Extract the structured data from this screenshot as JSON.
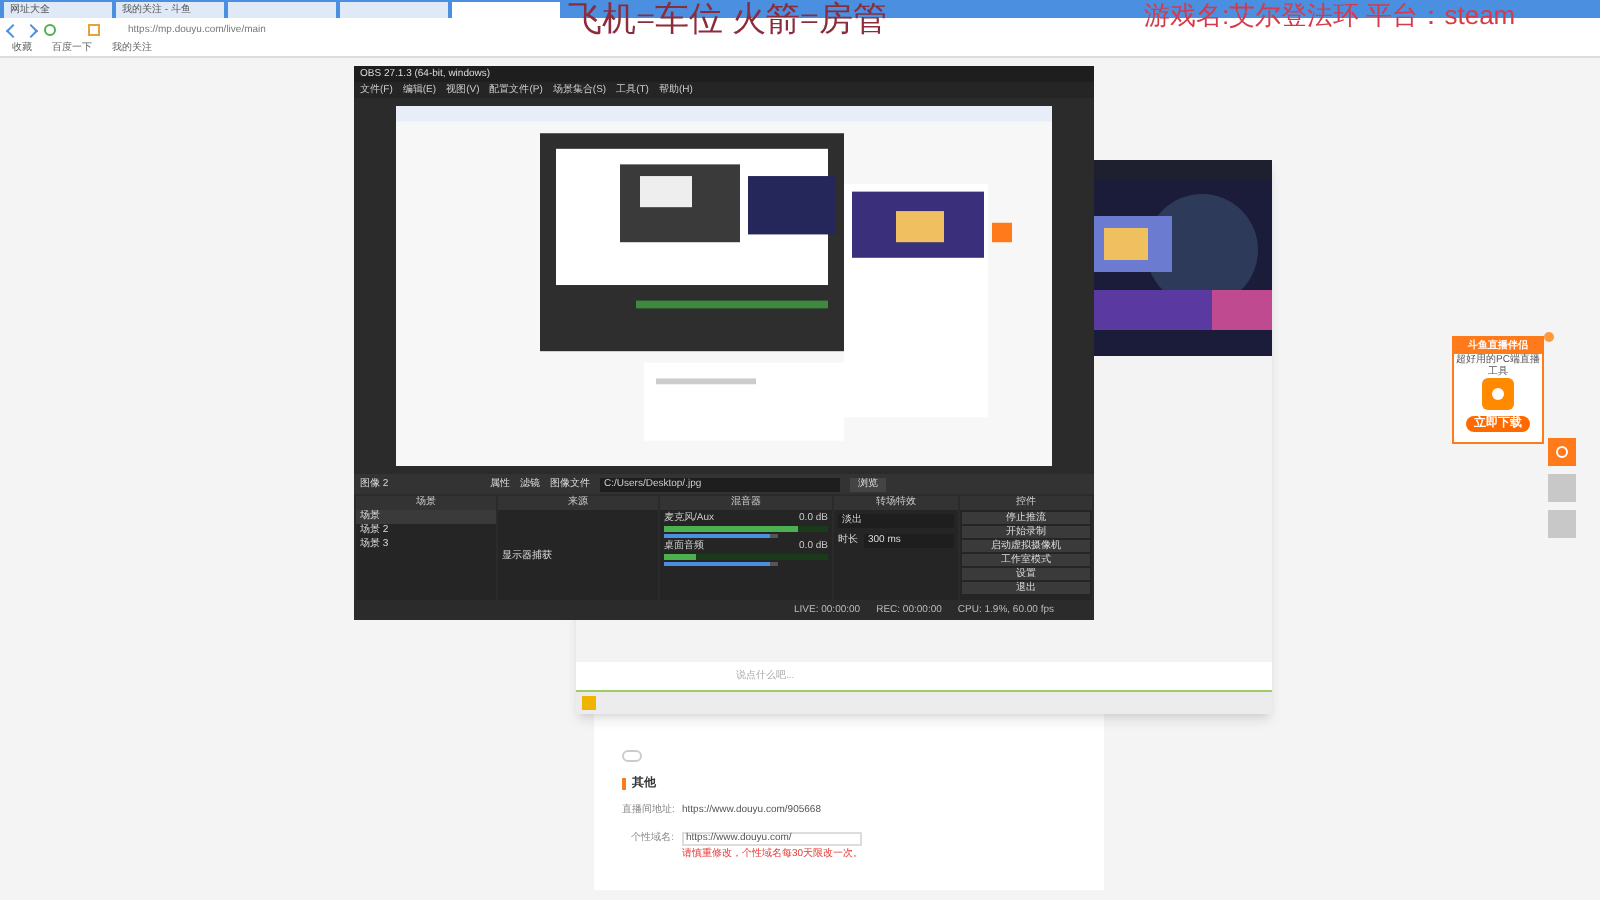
{
  "browser": {
    "tabs": [
      {
        "label": "网址大全",
        "selected": false
      },
      {
        "label": "我的关注 - 斗鱼",
        "selected": false
      },
      {
        "selected": false
      },
      {
        "selected": false
      },
      {
        "selected": true
      }
    ],
    "url": "https://mp.douyu.com/live/main",
    "bookmarks": [
      "收藏",
      "百度一下",
      "我的关注"
    ]
  },
  "overlay": {
    "left": "飞机=车位 火箭=房管",
    "right": "游戏名:艾尔登法环 平台：steam"
  },
  "page": {
    "section_title": "其他",
    "fields": [
      {
        "label": "直播间地址:",
        "value": "https://www.douyu.com/905668",
        "kind": "text"
      },
      {
        "label": "个性域名:",
        "value": "https://www.douyu.com/",
        "kind": "input"
      }
    ],
    "toggle": {
      "on": false
    },
    "hint": "请慎重修改，个性域名每30天限改一次。"
  },
  "ad": {
    "title": "斗鱼直播伴侣",
    "subtitle": "超好用的PC端直播工具",
    "button": "立即下载"
  },
  "companion": {
    "placeholder": "说点什么吧..."
  },
  "obs": {
    "title": "OBS 27.1.3 (64-bit, windows)",
    "menu": [
      "文件(F)",
      "编辑(E)",
      "视图(V)",
      "配置文件(P)",
      "场景集合(S)",
      "工具(T)",
      "帮助(H)"
    ],
    "source_bar": {
      "source": "图像 2",
      "buttons": [
        "属性",
        "滤镜"
      ],
      "file_label": "图像文件",
      "path": "C:/Users/Desktop/.jpg",
      "browse": "浏览"
    },
    "docks": [
      "场景",
      "来源",
      "混音器",
      "转场特效",
      "控件"
    ],
    "scenes": [
      {
        "label": "场景",
        "selected": true
      },
      {
        "label": "场景 2",
        "selected": false
      },
      {
        "label": "场景 3",
        "selected": false
      }
    ],
    "sources": [
      {
        "label": "显示器捕获",
        "selected": false
      }
    ],
    "mixer": [
      {
        "name": "麦克风/Aux",
        "reading": "0.0 dB",
        "meter": {
          "level": 0.82
        },
        "volume": {
          "level": 0.92
        }
      },
      {
        "name": "桌面音频",
        "reading": "0.0 dB",
        "meter": {
          "level": 0.2
        },
        "volume": {
          "level": 0.92
        }
      }
    ],
    "transition": {
      "value": "淡出",
      "duration_label": "时长",
      "duration": "300 ms"
    },
    "controls": [
      "停止推流",
      "开始录制",
      "启动虚拟摄像机",
      "工作室模式",
      "设置",
      "退出"
    ],
    "status": [
      "LIVE: 00:00:00",
      "REC: 00:00:00",
      "CPU: 1.9%, 60.00 fps"
    ]
  }
}
